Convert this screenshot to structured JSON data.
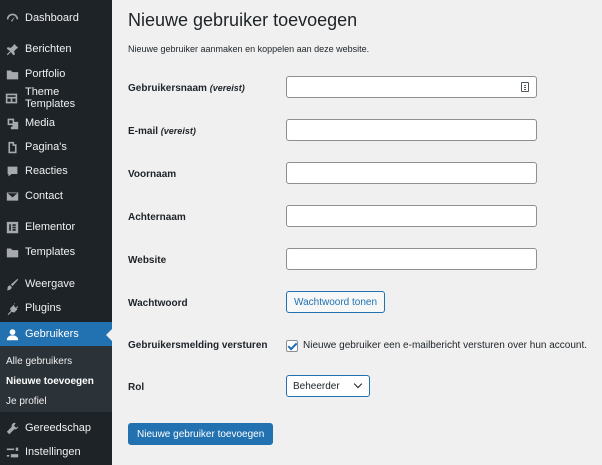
{
  "sidebar": {
    "items": [
      {
        "label": "Dashboard",
        "icon": "dashboard-icon"
      },
      {
        "label": "Berichten",
        "icon": "pushpin-icon"
      },
      {
        "label": "Portfolio",
        "icon": "folder-icon"
      },
      {
        "label": "Theme Templates",
        "icon": "table-icon"
      },
      {
        "label": "Media",
        "icon": "media-icon"
      },
      {
        "label": "Pagina's",
        "icon": "pages-icon"
      },
      {
        "label": "Reacties",
        "icon": "comment-icon"
      },
      {
        "label": "Contact",
        "icon": "mail-icon"
      },
      {
        "label": "Elementor",
        "icon": "elementor-icon"
      },
      {
        "label": "Templates",
        "icon": "folder-icon"
      },
      {
        "label": "Weergave",
        "icon": "brush-icon"
      },
      {
        "label": "Plugins",
        "icon": "plug-icon"
      },
      {
        "label": "Gebruikers",
        "icon": "user-icon"
      },
      {
        "label": "Gereedschap",
        "icon": "wrench-icon"
      },
      {
        "label": "Instellingen",
        "icon": "settings-icon"
      }
    ],
    "submenu": [
      "Alle gebruikers",
      "Nieuwe toevoegen",
      "Je profiel"
    ]
  },
  "page": {
    "title": "Nieuwe gebruiker toevoegen",
    "description": "Nieuwe gebruiker aanmaken en koppelen aan deze website."
  },
  "form": {
    "username_label": "Gebruikersnaam",
    "username_required": "(vereist)",
    "email_label": "E-mail",
    "email_required": "(vereist)",
    "firstname_label": "Voornaam",
    "lastname_label": "Achternaam",
    "website_label": "Website",
    "password_label": "Wachtwoord",
    "password_button": "Wachtwoord tonen",
    "notify_label": "Gebruikersmelding versturen",
    "notify_checkbox_label": "Nieuwe gebruiker een e-mailbericht versturen over hun account.",
    "role_label": "Rol",
    "role_value": "Beheerder",
    "submit_button": "Nieuwe gebruiker toevoegen"
  },
  "colors": {
    "accent": "#2271b1",
    "sidebar_bg": "#1d2327",
    "page_bg": "#f0f0f1"
  }
}
